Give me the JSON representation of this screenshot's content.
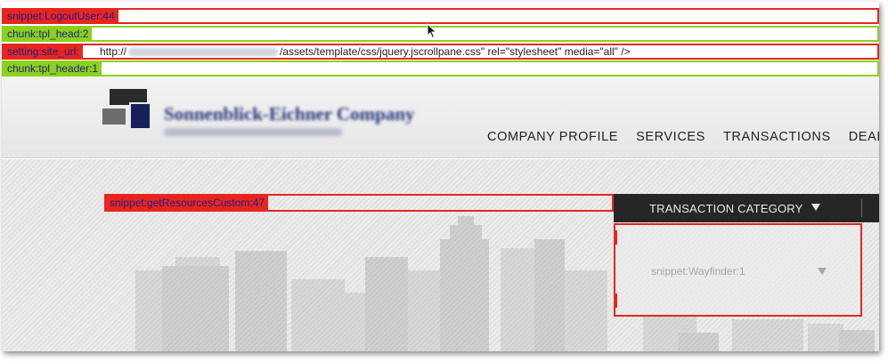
{
  "debug": {
    "logout": {
      "tag": "snippet:LogoutUser:44",
      "color": "#e8261e"
    },
    "head": {
      "tag": "chunk:tpl_head:2",
      "color": "#8cd11c"
    },
    "site_url": {
      "tag": "setting:site_url:",
      "text_before": "http://",
      "text_after": "/assets/template/css/jquery.jscrollpane.css\" rel=\"stylesheet\" media=\"all\" />",
      "color": "#e8261e"
    },
    "header": {
      "tag": "chunk:tpl_header:1",
      "color": "#8cd11c"
    }
  },
  "header": {
    "company_name": "Sonnenblick-Eichner Company",
    "nav": [
      "COMPANY PROFILE",
      "SERVICES",
      "TRANSACTIONS",
      "DEAL"
    ]
  },
  "hero": {
    "resources_tag": "snippet:getResourcesCustom:47",
    "category_label": "TRANSACTION CATEGORY",
    "wayfinder_label": "snippet:Wayfinder:1"
  },
  "colors": {
    "accent_red": "#e8261e",
    "chunk_green": "#8cd11c",
    "tag_text": "#1d1d8a",
    "category_bar": "#262626"
  }
}
